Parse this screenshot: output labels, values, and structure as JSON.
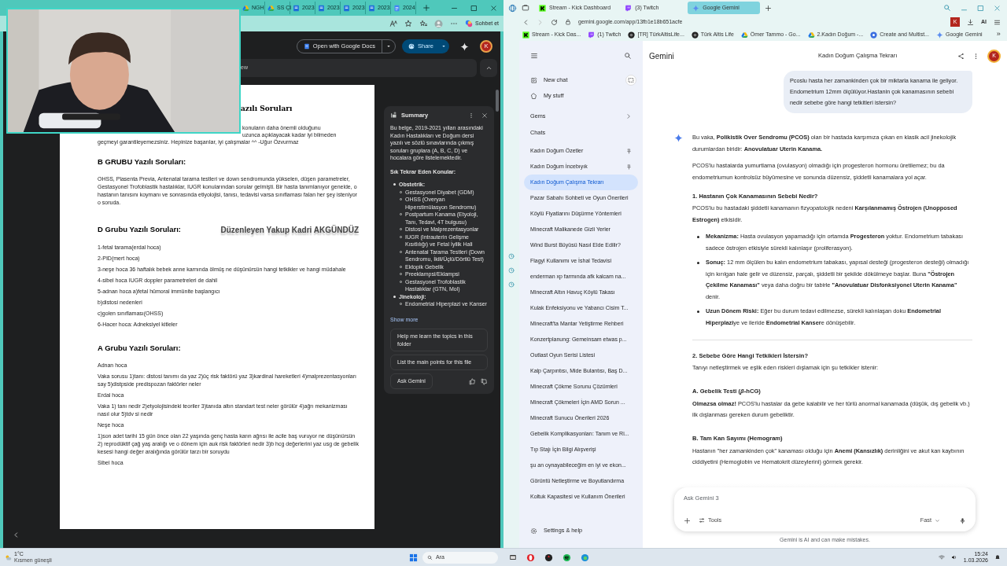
{
  "left_window": {
    "tabs": [
      {
        "label": "NGH",
        "kind": "drive"
      },
      {
        "label": "SS ÇI",
        "kind": "drive"
      },
      {
        "label": "2023",
        "kind": "word"
      },
      {
        "label": "2023",
        "kind": "word"
      },
      {
        "label": "2023",
        "kind": "word"
      },
      {
        "label": "2023",
        "kind": "word"
      },
      {
        "label": "2024",
        "kind": "docs"
      }
    ],
    "chat_button": "Sohbet et",
    "open_with": "Open with Google Docs",
    "share": "Share",
    "avatar": "K",
    "preview_bar": "ew",
    "document": [
      {
        "kind": "title",
        "text": "azılı Soruları"
      },
      {
        "kind": "fragment",
        "text": "konuların daha önemli olduğunu"
      },
      {
        "kind": "fragment",
        "text": "uzunca açıklayacak kadar iyi bilmeden"
      },
      {
        "kind": "line",
        "text": "geçmeyi garantileyemezsiniz. Hepinize başarılar, iyi çalışmalar ^^ -Uğur Özvurmaz"
      },
      {
        "kind": "heading",
        "text": "B GRUBU Yazılı Soruları:"
      },
      {
        "kind": "para",
        "text": "OHSS, Plasenta Previa, Antenatal tarama testleri ve down sendromunda yükselen, düşen parametreler, Gestasyonel Trofoblastik hastalıklar, IUGR konularından sorular gelmişti. Bir hasta tanımlanıyor genelde, o hastanın tanısını koymanı ve sonrasında etiyolojisi, tanısı, tedavisi varsa sınıflaması falan her şey isteniyor o soruda."
      },
      {
        "kind": "heading",
        "text": "D Grubu Yazılı Soruları:",
        "aside": "Düzenleyen Yakup Kadri AKGÜNDÜZ"
      },
      {
        "kind": "item",
        "text": "1-fetal tarama(erdal hoca)"
      },
      {
        "kind": "item",
        "text": "2-PID(mert hoca)"
      },
      {
        "kind": "item",
        "text": "3-neşe hoca 36 haftalık bebek anne karnında ölmüş ne düşünürsün hangi tetkikler ve hangi müdahale"
      },
      {
        "kind": "item",
        "text": "4-sibel hoca IUGR doppler parametreleri de dahil"
      },
      {
        "kind": "item",
        "text": "5-adnan hoca a)fetal hümoral immünite başlangıcı"
      },
      {
        "kind": "item",
        "text": "b)distosi nedenleri"
      },
      {
        "kind": "item",
        "text": "c)golen sınıflaması(OHSS)"
      },
      {
        "kind": "item",
        "text": "6-Hacer hoca: Adneksiyel kitleler"
      },
      {
        "kind": "heading",
        "text": "A Grubu Yazılı Soruları:"
      },
      {
        "kind": "item",
        "text": "Adnan hoca"
      },
      {
        "kind": "item",
        "text": "Vaka sorusu 1)tanı: distosi tanımı da yaz 2)üç risk faktörü yaz 3)kardinal hareketleri 4)malprezentasyonları say 5)distpside predispozan faktörler neler"
      },
      {
        "kind": "item",
        "text": "Erdal hoca"
      },
      {
        "kind": "item",
        "text": "Vaka 1) tanı nedir 2)etyolojisindeki teoriler 3)tanıda altın standart test neler görülür 4)ağrı mekanizması nasıl olur 5)tdv si nedir"
      },
      {
        "kind": "item",
        "text": "Neşe hoca"
      },
      {
        "kind": "item",
        "text": "1)son adet tarihi 15 gün önce olan 22 yaşında genç hasta karın ağrısı ile acile baş vuruyor ne düşünürsün 2) reprodüktif çağ yaş aralığı ve o dönem için auk risk faktörleri nedir 3)b hcg değerlerini yaz usg de gebelik kesesi hangi değer aralığında görülür tarzı bir soruydu"
      },
      {
        "kind": "item",
        "text": "Sibel hoca"
      }
    ],
    "summary": {
      "title": "Summary",
      "intro": "Bu belge, 2019-2021 yılları arasındaki Kadın Hastalıkları ve Doğum dersi yazılı ve sözlü sınavlarında çıkmış soruları gruplara (A, B, C, D) ve hocalara göre listelemektedir.",
      "subtitle": "Sık Tekrar Eden Konular:",
      "topics": [
        {
          "label": "Obstetrik:",
          "children": [
            {
              "label": "Gestasyonel Diyabet (GDM)"
            },
            {
              "label": "OHSS (Overyan Hiperstimülasyon Sendromu)"
            },
            {
              "label": "Postpartum Kanama (Etyoloji, Tanı, Tedavi, 4T bulgusu)"
            },
            {
              "label": "Distosi ve Malprezentasyonlar"
            },
            {
              "label": "IUGR (Intrauterin Gelişme Kısıtlılığı) ve Fetal İyilik Hali"
            },
            {
              "label": "Antenatal Tarama Testleri (Down Sendromu, İkili/Üçlü/Dörtlü Test)"
            },
            {
              "label": "Ektopik Gebelik"
            },
            {
              "label": "Preeklampsi/Eklampsi"
            },
            {
              "label": "Gestasyonel Trofoblastik Hastalıklar (GTN, Mol)"
            }
          ]
        },
        {
          "label": "Jinekoloji:",
          "children": [
            {
              "label": "Endometrial Hiperplazi ve Kanser"
            }
          ]
        }
      ],
      "show_more": "Show more",
      "suggestions": [
        "Help me learn the topics in this folder",
        "List the main points for this file"
      ],
      "ask": "Ask Gemini"
    }
  },
  "right_window": {
    "tabs": [
      {
        "label": "Stream - Kick Dashboard",
        "kind": "kick",
        "selected": false
      },
      {
        "label": "(3) Twitch",
        "kind": "twitch",
        "selected": false
      },
      {
        "label": "Google Gemini",
        "kind": "gemini",
        "selected": true
      }
    ],
    "url": "gemini.google.com/app/13fb1e18b651acfe",
    "profile": "K",
    "ai": "AI",
    "bookmarks": [
      {
        "label": "Stream - Kick Das...",
        "kind": "kick"
      },
      {
        "label": "(1) Twitch",
        "kind": "twitch"
      },
      {
        "label": "[TR] TürkAltisLife...",
        "kind": "dark"
      },
      {
        "label": "Türk Altis Life",
        "kind": "dark"
      },
      {
        "label": "Ömer Tammo - Go...",
        "kind": "drive"
      },
      {
        "label": "2.Kadın Doğum -...",
        "kind": "drive"
      },
      {
        "label": "Create and Multist...",
        "kind": "blue"
      },
      {
        "label": "Google Gemini",
        "kind": "gemini"
      }
    ],
    "more_bookmarks": "»",
    "app": {
      "brand": "Gemini",
      "chat_title": "Kadın Doğum Çalışma Tekrarı",
      "avatar": "K",
      "new_chat": "New chat",
      "my_stuff": "My stuff",
      "gems": "Gems",
      "chats_heading": "Chats",
      "chats": [
        {
          "label": "Kadın Doğum Özetler",
          "pinned": true,
          "selected": false
        },
        {
          "label": "Kadın Doğum İncebıyık",
          "pinned": true,
          "selected": false
        },
        {
          "label": "Kadın Doğum Çalışma Tekrarı",
          "pinned": false,
          "selected": true
        },
        {
          "label": "Pazar Sabahı Sohbeti ve Oyun Önerileri",
          "pinned": false,
          "selected": false
        },
        {
          "label": "Köylü Fiyatlarını Düşürme Yöntemleri",
          "pinned": false,
          "selected": false
        },
        {
          "label": "Minecraft Malikanede Gizli Yerler",
          "pinned": false,
          "selected": false
        },
        {
          "label": "Wind Burst Büyüsü Nasıl Elde Edilir?",
          "pinned": false,
          "selected": false
        },
        {
          "label": "Flagyl Kullanımı ve İshal Tedavisi",
          "pinned": false,
          "selected": false
        },
        {
          "label": "enderman xp farmında afk kalcam na...",
          "pinned": false,
          "selected": false
        },
        {
          "label": "Minecraft Altın Havuç Köylü Takası",
          "pinned": false,
          "selected": false
        },
        {
          "label": "Kulak Enfeksiyonu ve Yabancı Cisim T...",
          "pinned": false,
          "selected": false
        },
        {
          "label": "Minecraft'ta Mantar Yetiştirme Rehberi",
          "pinned": false,
          "selected": false
        },
        {
          "label": "Konzertplanung: Gemeinsam etwas p...",
          "pinned": false,
          "selected": false
        },
        {
          "label": "Outlast Oyun Serisi Listesi",
          "pinned": false,
          "selected": false
        },
        {
          "label": "Kalp Çarpıntısı, Mide Bulantısı, Baş D...",
          "pinned": false,
          "selected": false
        },
        {
          "label": "Minecraft Çökme Sorunu Çözümleri",
          "pinned": false,
          "selected": false
        },
        {
          "label": "Minecraft Çökmeleri İçin AMD Sorun ...",
          "pinned": false,
          "selected": false
        },
        {
          "label": "Minecraft Sunucu Önerileri 2026",
          "pinned": false,
          "selected": false
        },
        {
          "label": "Gebelik Komplikasyonları: Tanım ve Ri...",
          "pinned": false,
          "selected": false
        },
        {
          "label": "Tıp Stajı İçin Bilgi Alışverişi",
          "pinned": false,
          "selected": false
        },
        {
          "label": "şu an oynayabileceğim en iyi ve ekon...",
          "pinned": false,
          "selected": false
        },
        {
          "label": "Görüntü Netleştirme ve Boyutlandırma",
          "pinned": false,
          "selected": false
        },
        {
          "label": "Koltuk Kapasitesi ve Kullanım Önerileri",
          "pinned": false,
          "selected": false
        }
      ],
      "settings": "Settings & help",
      "user_message": "Pcoslu hasta her zamankinden çok bir miktarla kanama ile geliyor. Endometrium 12mm ölçülüyor.Hastanin çok kanamasının sebebi nedir sebebe göre hangi tetkitleri istersin?",
      "response": [
        {
          "kind": "p",
          "text": "Bu vaka, **Polikistik Over Sendromu (PCOS)** olan bir hastada karşımıza çıkan en klasik acil jinekolojik durumlardan biridir: **Anovulatuar Uterin Kanama.**"
        },
        {
          "kind": "p",
          "text": "PCOS'lu hastalarda yumurtlama (ovulasyon) olmadığı için progesteron hormonu üretilemez; bu da endometriumun kontrolsüz büyümesine ve sonunda düzensiz, şiddetli kanamalara yol açar."
        },
        {
          "kind": "h3",
          "text": "1. Hastanın Çok Kanamasının Sebebi Nedir?"
        },
        {
          "kind": "p",
          "text": "PCOS'lu bu hastadaki şiddetli kanamanın fizyopatolojik nedeni **Karşılanmamış Östrojen (Unopposed Estrogen)** etkisidir."
        },
        {
          "kind": "bullets",
          "items": [
            "**Mekanizma:** Hasta ovulasyon yapamadığı için ortamda **Progesteron** yoktur. Endometrium tabakası sadece östrojen etkisiyle sürekli kalınlaşır (proliferasyon).",
            "**Sonuç:** 12 mm ölçülen bu kalın endometrium tabakası, yapısal desteği (progesteron desteği) olmadığı için kırılgan hale gelir ve düzensiz, parçalı, şiddetli bir şekilde dökülmeye başlar. Buna **\"Östrojen Çekilme Kanaması\"** veya daha doğru bir tabirle **\"Anovulatuar Disfonksiyonel Uterin Kanama\"** denir.",
            "**Uzun Dönem Riski:** Eğer bu durum tedavi edilmezse, sürekli kalınlaşan doku **Endometrial Hiperplazi**ye ve ileride **Endometrial Kanser**e dönüşebilir."
          ]
        },
        {
          "kind": "rule"
        },
        {
          "kind": "h3",
          "text": "2. Sebebe Göre Hangi Tetkikleri İstersin?"
        },
        {
          "kind": "p",
          "text": "Tanıyı netleştirmek ve eşlik eden riskleri dışlamak için şu tetkikler istenir:"
        },
        {
          "kind": "h4",
          "text": "A. Gebelik Testi (*β*-hCG)"
        },
        {
          "kind": "p",
          "text": "**Olmazsa olmaz!** PCOS'lu hastalar da gebe kalabilir ve her türlü anormal kanamada (düşük, dış gebelik vb.) ilk dışlanması gereken durum gebeliktir."
        },
        {
          "kind": "h4",
          "text": "B. Tam Kan Sayımı (Hemogram)"
        },
        {
          "kind": "p",
          "text": "Hastanın \"her zamankinden çok\" kanaması olduğu için **Anemi (Kansızlık)** derinliğini ve akut kan kaybının ciddiyetini (Hemoglobin ve Hematokrit düzeylerini) görmek gerekir."
        }
      ],
      "input_placeholder": "Ask Gemini 3",
      "tools": "Tools",
      "mode": "Fast",
      "disclaimer": "Gemini is AI and can make mistakes."
    }
  },
  "taskbar": {
    "temperature": "1°C",
    "weather": "Kısmen güneşli",
    "search": "Ara",
    "time": "15:24",
    "date": "1.03.2026"
  }
}
